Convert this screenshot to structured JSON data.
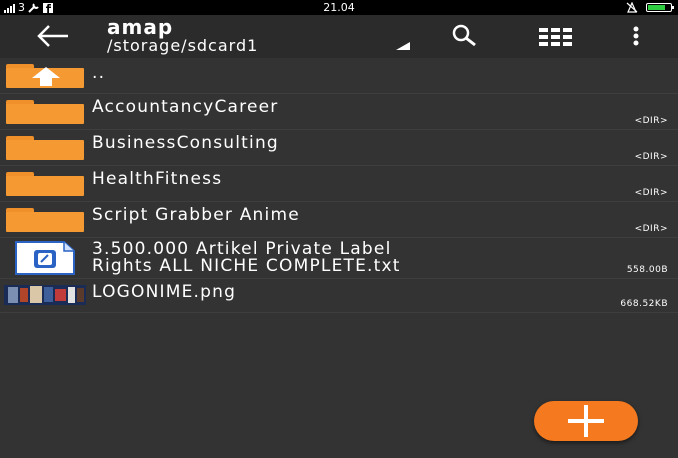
{
  "status_bar": {
    "signal_label": "3",
    "time": "21.04"
  },
  "toolbar": {
    "title": "amap",
    "path": "/storage/sdcard1"
  },
  "files": [
    {
      "name": "..",
      "meta": "",
      "kind": "parent-folder"
    },
    {
      "name": "AccountancyCareer",
      "meta": "<DIR>",
      "kind": "folder"
    },
    {
      "name": "BusinessConsulting",
      "meta": "<DIR>",
      "kind": "folder"
    },
    {
      "name": "HealthFitness",
      "meta": "<DIR>",
      "kind": "folder"
    },
    {
      "name": "Script Grabber Anime",
      "meta": "<DIR>",
      "kind": "folder"
    },
    {
      "name_line1": "3.500.000 Artikel Private Label",
      "name_line2": "Rights ALL NICHE COMPLETE.txt",
      "meta": "558.00B",
      "kind": "text-file"
    },
    {
      "name": "LOGONIME.png",
      "meta": "668.52KB",
      "kind": "image-file"
    }
  ],
  "colors": {
    "background": "#333333",
    "toolbar": "#2b2b2b",
    "folder": "#f59a33",
    "fab": "#f57a1f"
  }
}
